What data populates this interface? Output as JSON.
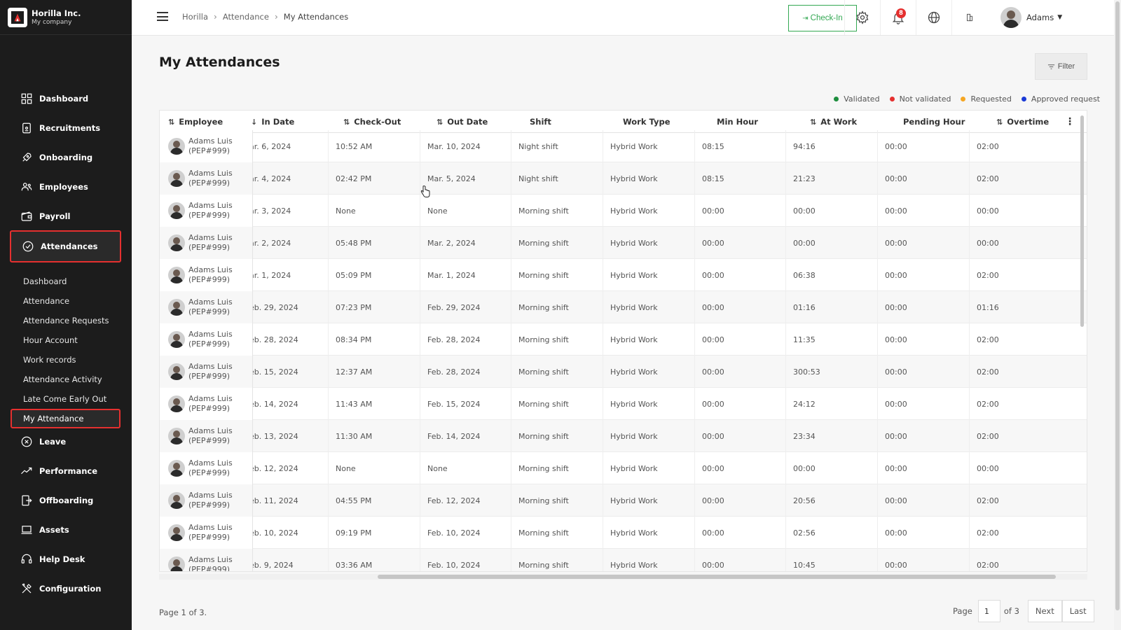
{
  "brand": {
    "name": "Horilla Inc.",
    "subtitle": "My company"
  },
  "sidebar": {
    "items": [
      {
        "label": "Dashboard",
        "icon": "grid-icon"
      },
      {
        "label": "Recruitments",
        "icon": "clipboard-icon"
      },
      {
        "label": "Onboarding",
        "icon": "rocket-icon"
      },
      {
        "label": "Employees",
        "icon": "people-icon"
      },
      {
        "label": "Payroll",
        "icon": "wallet-icon"
      },
      {
        "label": "Attendances",
        "icon": "check-circle-icon"
      },
      {
        "label": "Leave",
        "icon": "x-circle-icon"
      },
      {
        "label": "Performance",
        "icon": "trend-icon"
      },
      {
        "label": "Offboarding",
        "icon": "exit-icon"
      },
      {
        "label": "Assets",
        "icon": "laptop-icon"
      },
      {
        "label": "Help Desk",
        "icon": "headset-icon"
      },
      {
        "label": "Configuration",
        "icon": "tools-icon"
      }
    ],
    "sub_items": [
      "Dashboard",
      "Attendance",
      "Attendance Requests",
      "Hour Account",
      "Work records",
      "Attendance Activity",
      "Late Come Early Out",
      "My Attendance"
    ]
  },
  "topbar": {
    "breadcrumb": [
      "Horilla",
      "Attendance",
      "My Attendances"
    ],
    "checkin_label": "Check-In",
    "notification_count": "8",
    "user_name": "Adams"
  },
  "main": {
    "title": "My Attendances",
    "filter_label": "Filter",
    "legend": [
      {
        "label": "Validated",
        "color": "#1e8e3e"
      },
      {
        "label": "Not validated",
        "color": "#e5302f"
      },
      {
        "label": "Requested",
        "color": "#f5a623"
      },
      {
        "label": "Approved request",
        "color": "#1a3ad6"
      }
    ]
  },
  "table": {
    "headers": {
      "employee": "Employee",
      "in_date": "In Date",
      "check_out": "Check-Out",
      "out_date": "Out Date",
      "shift": "Shift",
      "work_type": "Work Type",
      "min_hour": "Min Hour",
      "at_work": "At Work",
      "pending_hour": "Pending Hour",
      "overtime": "Overtime"
    },
    "rows": [
      {
        "status": "#e5302f",
        "employee": "Adams Luis",
        "badge": "(PEP#999)",
        "in_date": "ar. 6, 2024",
        "check_out": "10:52 AM",
        "out_date": "Mar. 10, 2024",
        "shift": "Night shift",
        "work_type": "Hybrid Work",
        "min_hour": "08:15",
        "at_work": "94:16",
        "pending_hour": "00:00",
        "overtime": "02:00"
      },
      {
        "status": "#1e8e3e",
        "employee": "Adams Luis",
        "badge": "(PEP#999)",
        "in_date": "ar. 4, 2024",
        "check_out": "02:42 PM",
        "out_date": "Mar. 5, 2024",
        "shift": "Night shift",
        "work_type": "Hybrid Work",
        "min_hour": "08:15",
        "at_work": "21:23",
        "pending_hour": "00:00",
        "overtime": "02:00"
      },
      {
        "status": "#1e8e3e",
        "employee": "Adams Luis",
        "badge": "(PEP#999)",
        "in_date": "ar. 3, 2024",
        "check_out": "None",
        "out_date": "None",
        "shift": "Morning shift",
        "work_type": "Hybrid Work",
        "min_hour": "00:00",
        "at_work": "00:00",
        "pending_hour": "00:00",
        "overtime": "00:00"
      },
      {
        "status": "#1e8e3e",
        "employee": "Adams Luis",
        "badge": "(PEP#999)",
        "in_date": "ar. 2, 2024",
        "check_out": "05:48 PM",
        "out_date": "Mar. 2, 2024",
        "shift": "Morning shift",
        "work_type": "Hybrid Work",
        "min_hour": "00:00",
        "at_work": "00:00",
        "pending_hour": "00:00",
        "overtime": "00:00"
      },
      {
        "status": "#1e8e3e",
        "employee": "Adams Luis",
        "badge": "(PEP#999)",
        "in_date": "ar. 1, 2024",
        "check_out": "05:09 PM",
        "out_date": "Mar. 1, 2024",
        "shift": "Morning shift",
        "work_type": "Hybrid Work",
        "min_hour": "00:00",
        "at_work": "06:38",
        "pending_hour": "00:00",
        "overtime": "02:00"
      },
      {
        "status": "#1e8e3e",
        "employee": "Adams Luis",
        "badge": "(PEP#999)",
        "in_date": "eb. 29, 2024",
        "check_out": "07:23 PM",
        "out_date": "Feb. 29, 2024",
        "shift": "Morning shift",
        "work_type": "Hybrid Work",
        "min_hour": "00:00",
        "at_work": "01:16",
        "pending_hour": "00:00",
        "overtime": "01:16"
      },
      {
        "status": "#1e8e3e",
        "employee": "Adams Luis",
        "badge": "(PEP#999)",
        "in_date": "eb. 28, 2024",
        "check_out": "08:34 PM",
        "out_date": "Feb. 28, 2024",
        "shift": "Morning shift",
        "work_type": "Hybrid Work",
        "min_hour": "00:00",
        "at_work": "11:35",
        "pending_hour": "00:00",
        "overtime": "02:00"
      },
      {
        "status": "#1e8e3e",
        "employee": "Adams Luis",
        "badge": "(PEP#999)",
        "in_date": "eb. 15, 2024",
        "check_out": "12:37 AM",
        "out_date": "Feb. 28, 2024",
        "shift": "Morning shift",
        "work_type": "Hybrid Work",
        "min_hour": "00:00",
        "at_work": "300:53",
        "pending_hour": "00:00",
        "overtime": "02:00"
      },
      {
        "status": "#1e8e3e",
        "employee": "Adams Luis",
        "badge": "(PEP#999)",
        "in_date": "eb. 14, 2024",
        "check_out": "11:43 AM",
        "out_date": "Feb. 15, 2024",
        "shift": "Morning shift",
        "work_type": "Hybrid Work",
        "min_hour": "00:00",
        "at_work": "24:12",
        "pending_hour": "00:00",
        "overtime": "02:00"
      },
      {
        "status": "#1e8e3e",
        "employee": "Adams Luis",
        "badge": "(PEP#999)",
        "in_date": "eb. 13, 2024",
        "check_out": "11:30 AM",
        "out_date": "Feb. 14, 2024",
        "shift": "Morning shift",
        "work_type": "Hybrid Work",
        "min_hour": "00:00",
        "at_work": "23:34",
        "pending_hour": "00:00",
        "overtime": "02:00"
      },
      {
        "status": "#1a3ad6",
        "employee": "Adams Luis",
        "badge": "(PEP#999)",
        "in_date": "eb. 12, 2024",
        "check_out": "None",
        "out_date": "None",
        "shift": "Morning shift",
        "work_type": "Hybrid Work",
        "min_hour": "00:00",
        "at_work": "00:00",
        "pending_hour": "00:00",
        "overtime": "00:00"
      },
      {
        "status": "#1e8e3e",
        "employee": "Adams Luis",
        "badge": "(PEP#999)",
        "in_date": "eb. 11, 2024",
        "check_out": "04:55 PM",
        "out_date": "Feb. 12, 2024",
        "shift": "Morning shift",
        "work_type": "Hybrid Work",
        "min_hour": "00:00",
        "at_work": "20:56",
        "pending_hour": "00:00",
        "overtime": "02:00"
      },
      {
        "status": "#1e8e3e",
        "employee": "Adams Luis",
        "badge": "(PEP#999)",
        "in_date": "eb. 10, 2024",
        "check_out": "09:19 PM",
        "out_date": "Feb. 10, 2024",
        "shift": "Morning shift",
        "work_type": "Hybrid Work",
        "min_hour": "00:00",
        "at_work": "02:56",
        "pending_hour": "00:00",
        "overtime": "02:00"
      },
      {
        "status": "#1e8e3e",
        "employee": "Adams Luis",
        "badge": "(PEP#999)",
        "in_date": "eb. 9, 2024",
        "check_out": "03:36 AM",
        "out_date": "Feb. 10, 2024",
        "shift": "Morning shift",
        "work_type": "Hybrid Work",
        "min_hour": "00:00",
        "at_work": "10:45",
        "pending_hour": "00:00",
        "overtime": "02:00"
      }
    ]
  },
  "pagination": {
    "info": "Page 1 of 3.",
    "page_label": "Page",
    "page_value": "1",
    "of_label": "of 3",
    "next_label": "Next",
    "last_label": "Last"
  }
}
